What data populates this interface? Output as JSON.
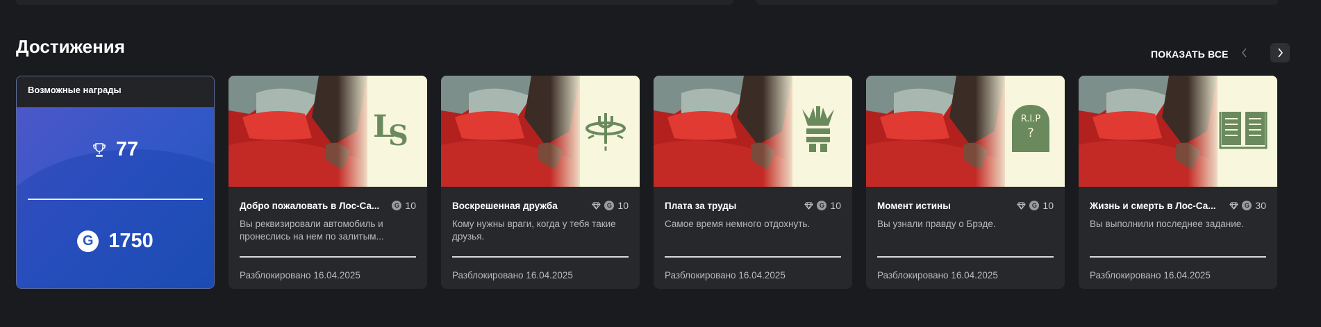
{
  "section": {
    "title": "Достижения",
    "show_all": "ПОКАЗАТЬ ВСЕ"
  },
  "rewards": {
    "title": "Возможные награды",
    "trophy_count": "77",
    "g_score": "1750",
    "g_letter": "G"
  },
  "achievements": [
    {
      "title": "Добро пожаловать в Лос-Са...",
      "points": "10",
      "has_gem": false,
      "emblem": "ls-logo-icon",
      "description": "Вы реквизировали автомобиль и пронеслись на нем по залитым...",
      "unlocked": "Разблокировано 16.04.2025"
    },
    {
      "title": "Воскрешенная дружба",
      "points": "10",
      "has_gem": true,
      "emblem": "trident-icon",
      "description": "Кому нужны враги, когда у тебя такие друзья.",
      "unlocked": "Разблокировано 16.04.2025"
    },
    {
      "title": "Плата за труды",
      "points": "10",
      "has_gem": true,
      "emblem": "bound-hands-icon",
      "description": "Самое время немного отдохнуть.",
      "unlocked": "Разблокировано 16.04.2025"
    },
    {
      "title": "Момент истины",
      "points": "10",
      "has_gem": true,
      "emblem": "tombstone-icon",
      "emblem_text": "R.I.P",
      "emblem_q": "?",
      "description": "Вы узнали правду о Брэде.",
      "unlocked": "Разблокировано 16.04.2025"
    },
    {
      "title": "Жизнь и смерть в Лос-Са...",
      "points": "30",
      "has_gem": true,
      "emblem": "book-icon",
      "description": "Вы выполнили последнее задание.",
      "unlocked": "Разблокировано 16.04.2025"
    }
  ],
  "colors": {
    "emblem": "#6a8a5e",
    "accent_blue": "#2d55c4",
    "card": "#26282c"
  }
}
